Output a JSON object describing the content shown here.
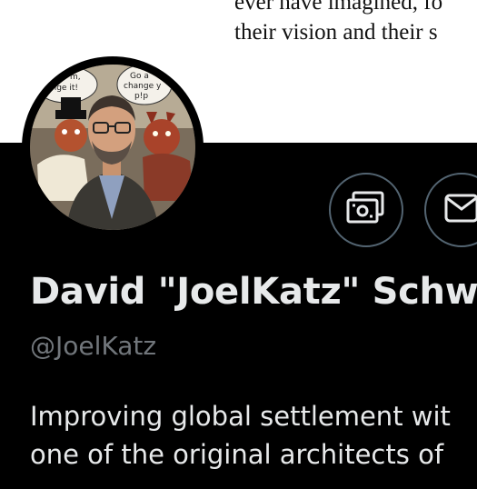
{
  "banner": {
    "lines": [
      "ever have imagined, fo",
      "their vision and their s"
    ]
  },
  "avatar": {
    "bubble_left": [
      "m,",
      "ange it!"
    ],
    "bubble_right": [
      "Go a",
      "change y",
      "p!p"
    ]
  },
  "profile": {
    "display_name": "David \"JoelKatz\" Schw",
    "handle": "@JoelKatz",
    "bio_lines": [
      "Improving global settlement wit",
      "one of the original architects of"
    ]
  },
  "colors": {
    "background": "#000000",
    "name": "#e7e9ea",
    "secondary": "#71767b",
    "button_border": "#536471"
  },
  "icons": [
    "tip-icon",
    "message-icon"
  ]
}
